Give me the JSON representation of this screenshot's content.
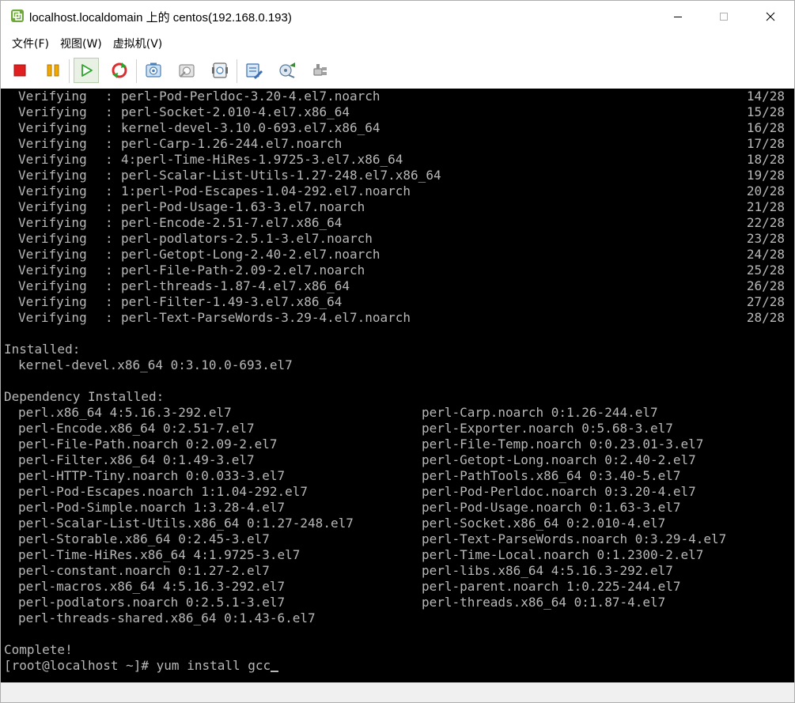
{
  "window": {
    "title": "localhost.localdomain 上的 centos(192.168.0.193)"
  },
  "menu": {
    "items": [
      "文件(F)",
      "视图(W)",
      "虚拟机(V)"
    ]
  },
  "toolbar": {
    "buttons": [
      {
        "icon": "stop-icon",
        "color": "#e02020"
      },
      {
        "icon": "pause-icon",
        "color": "#f2a800"
      },
      {
        "icon": "play-icon",
        "color": "#2aa52a"
      },
      {
        "icon": "reset-icon",
        "color": "#d83030"
      },
      {
        "icon": "snapshot-icon"
      },
      {
        "icon": "snapshot-revert-icon"
      },
      {
        "icon": "snapshot-manager-icon"
      },
      {
        "icon": "edit-settings-icon"
      },
      {
        "icon": "devices-icon"
      },
      {
        "icon": "connect-icon"
      }
    ]
  },
  "console": {
    "verify_label": "Verifying",
    "verify_colon": ":",
    "verify_rows": [
      {
        "pkg": "perl-Pod-Perldoc-3.20-4.el7.noarch",
        "count": "14/28"
      },
      {
        "pkg": "perl-Socket-2.010-4.el7.x86_64",
        "count": "15/28"
      },
      {
        "pkg": "kernel-devel-3.10.0-693.el7.x86_64",
        "count": "16/28"
      },
      {
        "pkg": "perl-Carp-1.26-244.el7.noarch",
        "count": "17/28"
      },
      {
        "pkg": "4:perl-Time-HiRes-1.9725-3.el7.x86_64",
        "count": "18/28"
      },
      {
        "pkg": "perl-Scalar-List-Utils-1.27-248.el7.x86_64",
        "count": "19/28"
      },
      {
        "pkg": "1:perl-Pod-Escapes-1.04-292.el7.noarch",
        "count": "20/28"
      },
      {
        "pkg": "perl-Pod-Usage-1.63-3.el7.noarch",
        "count": "21/28"
      },
      {
        "pkg": "perl-Encode-2.51-7.el7.x86_64",
        "count": "22/28"
      },
      {
        "pkg": "perl-podlators-2.5.1-3.el7.noarch",
        "count": "23/28"
      },
      {
        "pkg": "perl-Getopt-Long-2.40-2.el7.noarch",
        "count": "24/28"
      },
      {
        "pkg": "perl-File-Path-2.09-2.el7.noarch",
        "count": "25/28"
      },
      {
        "pkg": "perl-threads-1.87-4.el7.x86_64",
        "count": "26/28"
      },
      {
        "pkg": "perl-Filter-1.49-3.el7.x86_64",
        "count": "27/28"
      },
      {
        "pkg": "perl-Text-ParseWords-3.29-4.el7.noarch",
        "count": "28/28"
      }
    ],
    "installed_header": "Installed:",
    "installed_pkg": "kernel-devel.x86_64 0:3.10.0-693.el7",
    "dependency_header": "Dependency Installed:",
    "dependency_rows": [
      {
        "left": "perl.x86_64 4:5.16.3-292.el7",
        "right": "perl-Carp.noarch 0:1.26-244.el7"
      },
      {
        "left": "perl-Encode.x86_64 0:2.51-7.el7",
        "right": "perl-Exporter.noarch 0:5.68-3.el7"
      },
      {
        "left": "perl-File-Path.noarch 0:2.09-2.el7",
        "right": "perl-File-Temp.noarch 0:0.23.01-3.el7"
      },
      {
        "left": "perl-Filter.x86_64 0:1.49-3.el7",
        "right": "perl-Getopt-Long.noarch 0:2.40-2.el7"
      },
      {
        "left": "perl-HTTP-Tiny.noarch 0:0.033-3.el7",
        "right": "perl-PathTools.x86_64 0:3.40-5.el7"
      },
      {
        "left": "perl-Pod-Escapes.noarch 1:1.04-292.el7",
        "right": "perl-Pod-Perldoc.noarch 0:3.20-4.el7"
      },
      {
        "left": "perl-Pod-Simple.noarch 1:3.28-4.el7",
        "right": "perl-Pod-Usage.noarch 0:1.63-3.el7"
      },
      {
        "left": "perl-Scalar-List-Utils.x86_64 0:1.27-248.el7",
        "right": "perl-Socket.x86_64 0:2.010-4.el7"
      },
      {
        "left": "perl-Storable.x86_64 0:2.45-3.el7",
        "right": "perl-Text-ParseWords.noarch 0:3.29-4.el7"
      },
      {
        "left": "perl-Time-HiRes.x86_64 4:1.9725-3.el7",
        "right": "perl-Time-Local.noarch 0:1.2300-2.el7"
      },
      {
        "left": "perl-constant.noarch 0:1.27-2.el7",
        "right": "perl-libs.x86_64 4:5.16.3-292.el7"
      },
      {
        "left": "perl-macros.x86_64 4:5.16.3-292.el7",
        "right": "perl-parent.noarch 1:0.225-244.el7"
      },
      {
        "left": "perl-podlators.noarch 0:2.5.1-3.el7",
        "right": "perl-threads.x86_64 0:1.87-4.el7"
      },
      {
        "left": "perl-threads-shared.x86_64 0:1.43-6.el7",
        "right": ""
      }
    ],
    "complete": "Complete!",
    "prompt": "[root@localhost ~]# yum install gcc"
  }
}
